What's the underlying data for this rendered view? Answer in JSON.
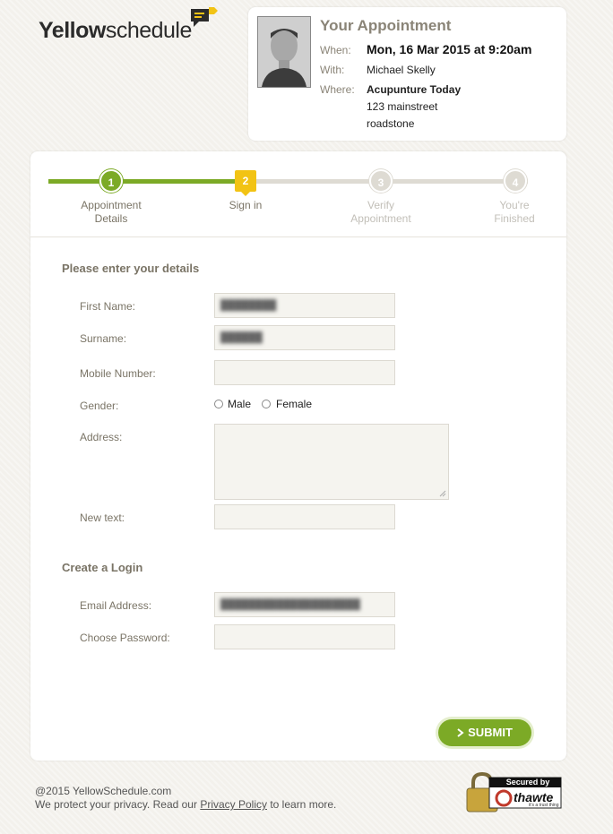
{
  "brand": {
    "logo_bold": "Yellow",
    "logo_light": "schedule"
  },
  "appointment": {
    "title": "Your Appointment",
    "when_key": "When:",
    "when_val": "Mon, 16 Mar 2015 at 9:20am",
    "with_key": "With:",
    "with_val": "Michael Skelly",
    "where_key": "Where:",
    "where_name": "Acupunture Today",
    "address_line1": "123 mainstreet",
    "address_line2": "roadstone"
  },
  "steps": [
    {
      "number": "1",
      "label_line1": "Appointment",
      "label_line2": "Details",
      "state": "done"
    },
    {
      "number": "2",
      "label_line1": "Sign in",
      "label_line2": "",
      "state": "current"
    },
    {
      "number": "3",
      "label_line1": "Verify",
      "label_line2": "Appointment",
      "state": "todo"
    },
    {
      "number": "4",
      "label_line1": "You're",
      "label_line2": "Finished",
      "state": "todo"
    }
  ],
  "form": {
    "section_details": "Please enter your details",
    "first_name_label": "First Name:",
    "first_name_value": "████████",
    "surname_label": "Surname:",
    "surname_value": "██████",
    "mobile_label": "Mobile Number:",
    "gender_label": "Gender:",
    "gender_male": "Male",
    "gender_female": "Female",
    "address_label": "Address:",
    "new_text_label": "New text:",
    "section_login": "Create a Login",
    "email_label": "Email Address:",
    "email_value": "████████████████████",
    "password_label": "Choose Password:",
    "submit_label": "SUBMIT"
  },
  "footer": {
    "copyright": "@2015 YellowSchedule.com",
    "privacy_prefix": "We protect your privacy. Read our ",
    "privacy_link": "Privacy Policy",
    "privacy_suffix": " to learn more."
  },
  "seal": {
    "secured_by": "Secured by",
    "brand": "thawte",
    "tagline": "it's a trust thing"
  },
  "colors": {
    "green": "#7caa26",
    "yellow": "#f2c314",
    "grey_step": "#d8d5ce"
  }
}
